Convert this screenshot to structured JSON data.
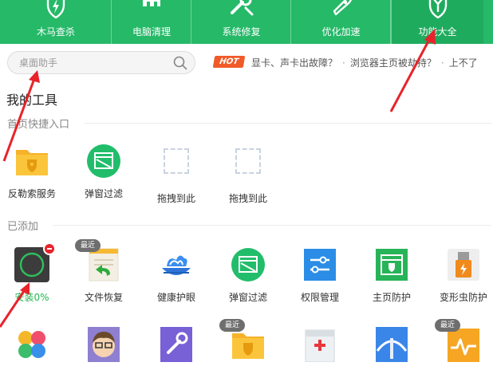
{
  "nav": {
    "items": [
      {
        "label": "木马查杀",
        "icon": "shield-lightning-icon"
      },
      {
        "label": "电脑清理",
        "icon": "broom-icon"
      },
      {
        "label": "系统修复",
        "icon": "wrench-icon"
      },
      {
        "label": "优化加速",
        "icon": "rocket-icon"
      },
      {
        "label": "功能大全",
        "icon": "shield-grid-icon"
      }
    ],
    "active_index": 4
  },
  "search": {
    "placeholder": "桌面助手",
    "icon": "search-icon"
  },
  "ticker": {
    "hot_label": "HOT",
    "items": [
      "显卡、声卡出故障？",
      "浏览器主页被劫持？",
      "上不了"
    ]
  },
  "page_title": "我的工具",
  "quick_entry": {
    "title": "首页快捷入口",
    "tools": [
      {
        "label": "反勒索服务",
        "icon": "folder-shield-icon"
      },
      {
        "label": "弹窗过滤",
        "icon": "popup-filter-icon"
      },
      {
        "label": "拖拽到此",
        "icon": "drop-target-icon"
      },
      {
        "label": "拖拽到此",
        "icon": "drop-target-icon"
      }
    ]
  },
  "added": {
    "title": "已添加",
    "tools_row1": [
      {
        "label": "安装0%",
        "icon": "installing-icon",
        "progress": 0
      },
      {
        "label": "文件恢复",
        "icon": "file-restore-icon",
        "badge": "最近"
      },
      {
        "label": "健康护眼",
        "icon": "eye-care-icon"
      },
      {
        "label": "弹窗过滤",
        "icon": "popup-filter-icon"
      },
      {
        "label": "权限管理",
        "icon": "permission-icon"
      },
      {
        "label": "主页防护",
        "icon": "homepage-guard-icon"
      },
      {
        "label": "变形虫防护",
        "icon": "usb-guard-icon"
      }
    ],
    "tools_row2": [
      {
        "icon": "flower-icon"
      },
      {
        "icon": "avatar-face-icon"
      },
      {
        "icon": "repair-tool-icon"
      },
      {
        "icon": "folder-shield-icon",
        "badge": "最近"
      },
      {
        "icon": "first-aid-kit-icon"
      },
      {
        "icon": "bridge-icon"
      },
      {
        "icon": "heartbeat-icon",
        "badge": "最近"
      }
    ]
  },
  "colors": {
    "brand": "#25b968",
    "hot": "#f05a28",
    "remove": "#e8232b",
    "arrow": "#e8232b"
  }
}
